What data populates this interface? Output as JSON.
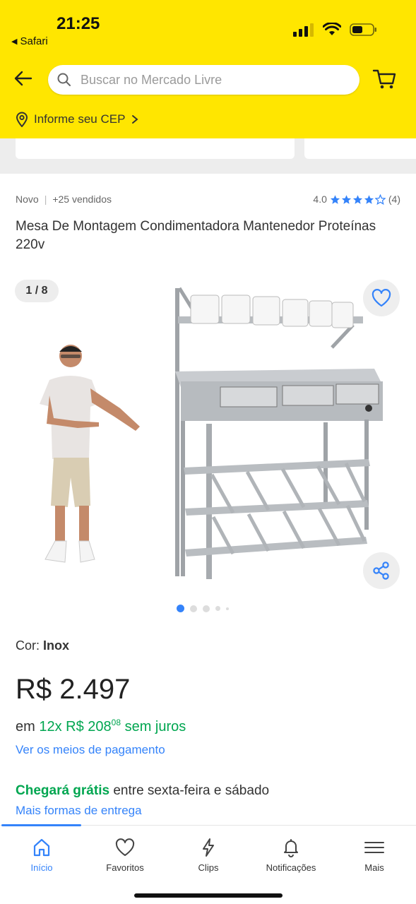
{
  "status": {
    "time": "21:25",
    "back_app": "Safari"
  },
  "header": {
    "search_placeholder": "Buscar no Mercado Livre",
    "cep_label": "Informe seu CEP",
    "icons": [
      "arrow-left-icon",
      "search-icon",
      "cart-icon",
      "location-pin-icon",
      "chevron-right-icon"
    ]
  },
  "product": {
    "condition": "Novo",
    "sold": "+25 vendidos",
    "rating_value": "4.0",
    "rating_stars": 4,
    "rating_count": "(4)",
    "title": "Mesa De Montagem Condimentadora Mantenedor Proteínas 220v",
    "image_counter": "1 / 8",
    "image_count": 8,
    "current_image": 1,
    "color_label": "Cor:",
    "color_value": "Inox",
    "price": "R$ 2.497",
    "installments_prefix": "em",
    "installments_main": "12x R$ 208",
    "installments_cents": "08",
    "installments_suffix": "sem juros",
    "payment_link": "Ver os meios de pagamento",
    "delivery_free": "Chegará grátis",
    "delivery_window": "entre sexta-feira e sábado",
    "delivery_link": "Mais formas de entrega"
  },
  "bottom_nav": {
    "items": [
      {
        "label": "Início",
        "icon": "home-icon",
        "active": true
      },
      {
        "label": "Favoritos",
        "icon": "heart-icon",
        "active": false
      },
      {
        "label": "Clips",
        "icon": "lightning-icon",
        "active": false
      },
      {
        "label": "Notificações",
        "icon": "bell-icon",
        "active": false
      },
      {
        "label": "Mais",
        "icon": "menu-icon",
        "active": false
      }
    ]
  },
  "colors": {
    "header_yellow": "#FFE600",
    "link_blue": "#3483FA",
    "green": "#00A650",
    "star_blue": "#3483FA"
  }
}
